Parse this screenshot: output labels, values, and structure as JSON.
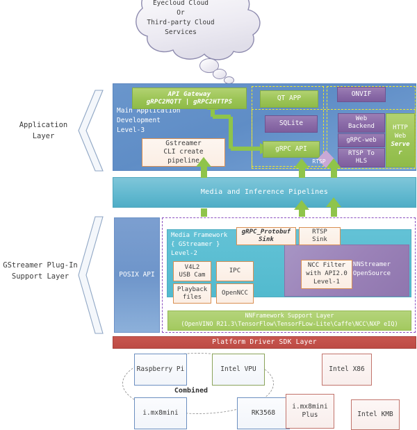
{
  "cloud": {
    "text": "Eyecloud Cloud\nOr\nThird-party Cloud\nServices"
  },
  "side_labels": {
    "application": "Application\nLayer",
    "gstreamer": "GStreamer Plug-In\nSupport Layer"
  },
  "application_layer": {
    "side_text": "Main Application\nDevelopment\nLevel-3",
    "api_gateway": {
      "line1": "API Gateway",
      "line2": "gRPC2MQTT | gRPC2HTTPS"
    },
    "qt_app": "QT APP",
    "onvif": "ONVIF",
    "sqlite": "SQLite",
    "grpc_api": "gRPC API",
    "web_backend": "Web\nBackend",
    "grpc_web": "gRPC-web",
    "rtsp_to_hls": "RTSP To\nHLS",
    "http_web_server": {
      "line1": "HTTP",
      "line2": "Web",
      "line3": "Serve",
      "line4": "r"
    },
    "gstreamer_cli": "Gstreamer\nCLI create\npipeline",
    "rtsp_diamond": "RTSP"
  },
  "pipelines_bar": {
    "label": "Media and Inference Pipelines"
  },
  "gstreamer_layer": {
    "posix_api": "POSIX API",
    "media_framework": "Media Framework\n{ GStreamer }\nLevel-2",
    "grpc_protobuf_sink": "gRPC_Protobuf\nSink",
    "rtsp_sink": "RTSP\nSink",
    "v4l2": "V4L2\nUSB Cam",
    "ipc": "IPC",
    "playback": "Playback\nfiles",
    "opennnc": "OpenNCC",
    "ncc_filter": "NCC Filter\nwith API2.0\nLevel-1",
    "nnstreamer": "NNStreamer\nOpenSource",
    "nnframework": {
      "line1": "NNFramework Support Layer",
      "line2": "(OpenVINO R21.3\\TensorFlow\\TensorFLow-Lite\\Caffe\\NCC\\NXP eIQ)"
    }
  },
  "platform_sdk": {
    "label": "Platform Driver SDK Layer"
  },
  "hardware": {
    "combined_label": "Combined",
    "raspberry_pi": "Raspberry Pi",
    "intel_vpu": "Intel VPU",
    "intel_x86": "Intel X86",
    "imx8mini": "i.mx8mini",
    "rk3568": "RK3568",
    "imx8mini_plus": "i.mx8mini\nPlus",
    "intel_kmb": "Intel KMB"
  },
  "colors": {
    "app_layer_blue": "#6a96cc",
    "green": "#9cc456",
    "purple": "#8a6aa7",
    "teal": "#63b9d0",
    "sdk_red": "#bd4b44",
    "yellow_dash": "#f2ea2a",
    "purple_dash": "#8b4fc0",
    "arrow_green": "#8fc44a"
  }
}
